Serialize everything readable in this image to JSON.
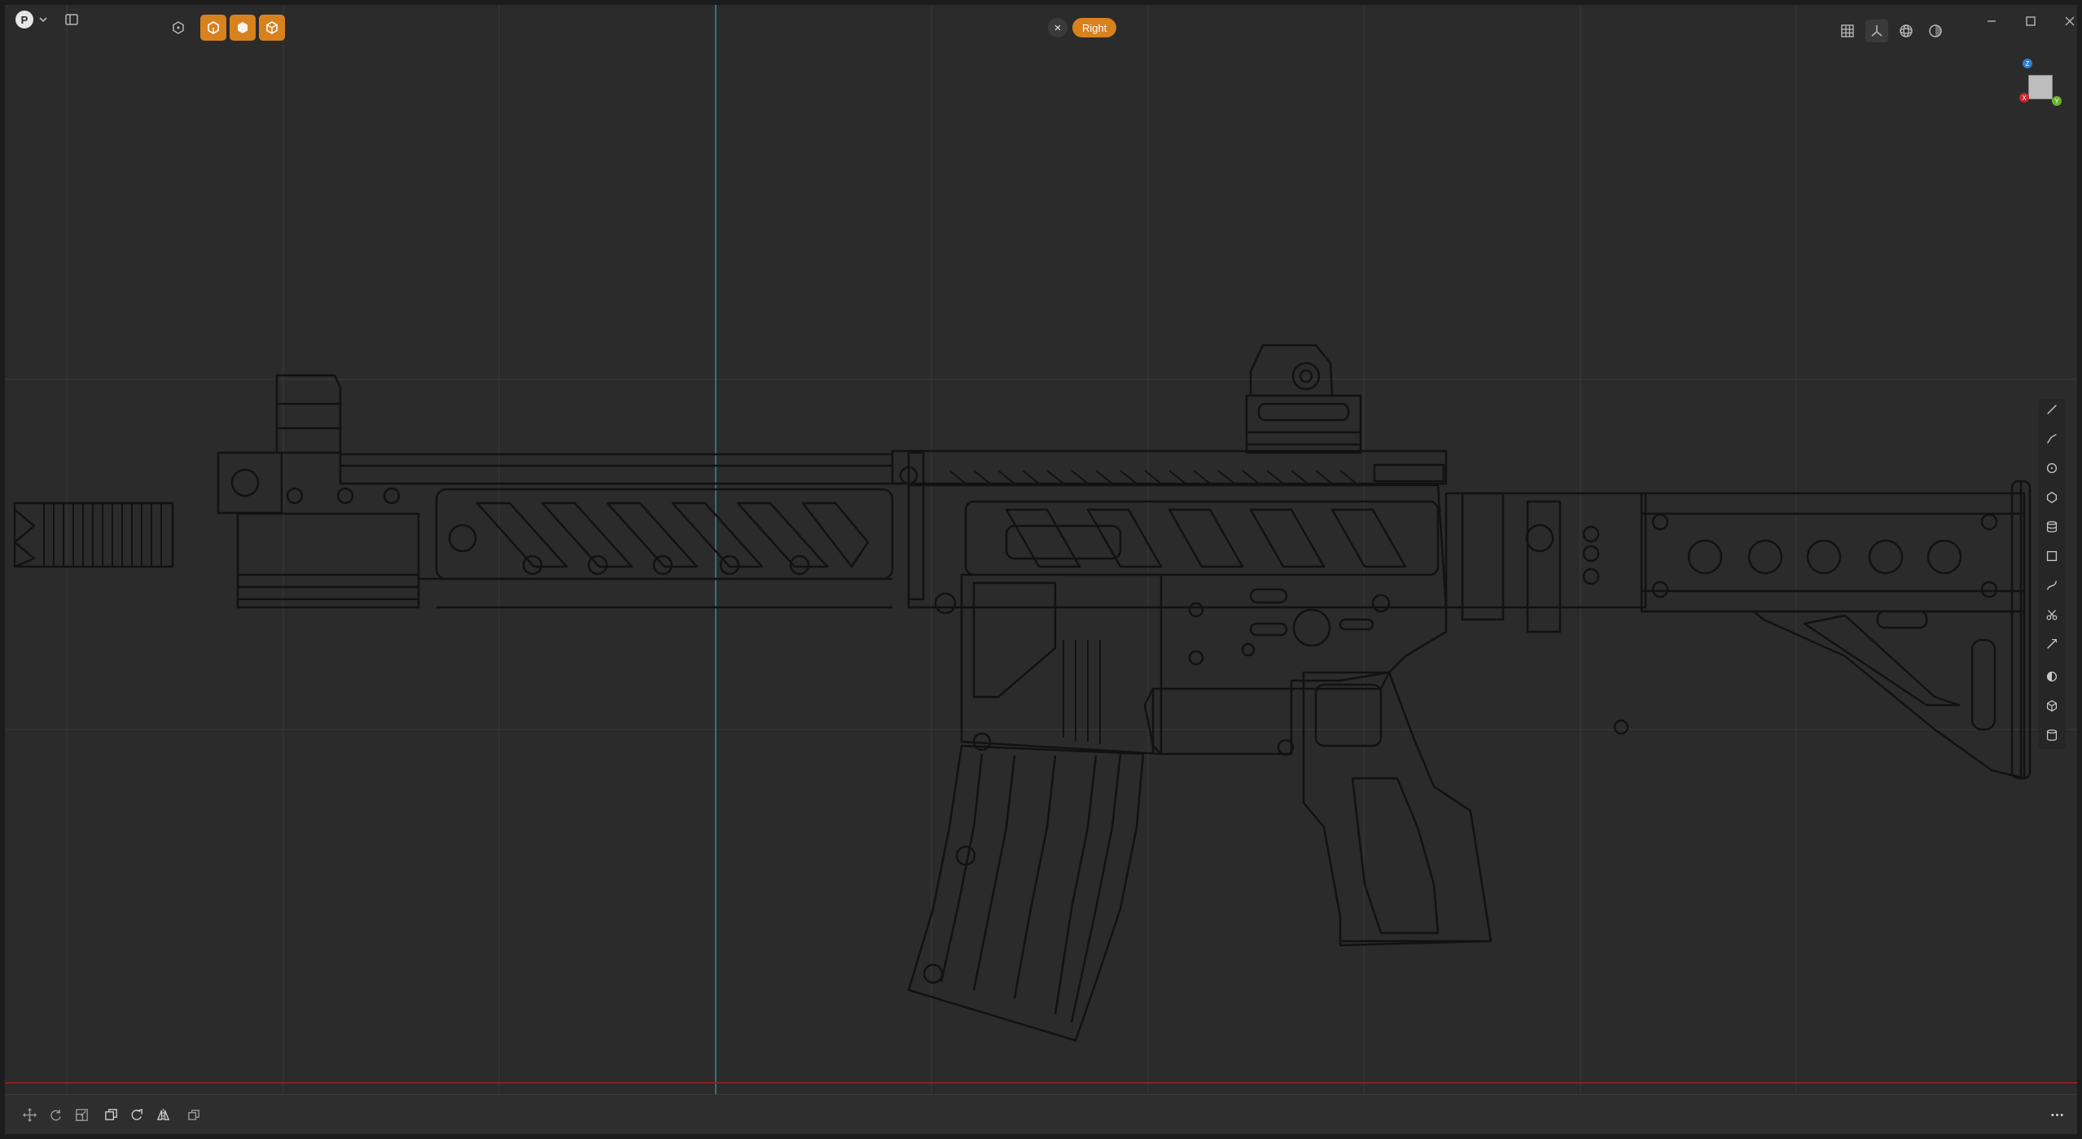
{
  "app": {
    "logo_letter": "P",
    "view_label": "Right"
  },
  "toolbar_left": [
    {
      "name": "object-mode-icon",
      "active": false
    },
    {
      "name": "solid-shading-icon",
      "active": true
    },
    {
      "name": "material-shading-icon",
      "active": true
    },
    {
      "name": "render-shading-icon",
      "active": true
    }
  ],
  "toolbar_right": [
    "grid-icon",
    "axes-icon",
    "wireframe-icon",
    "xray-icon"
  ],
  "right_tools": [
    "line-icon",
    "polyline-icon",
    "circle-icon",
    "polygon-icon",
    "cylinder-stack-icon",
    "rectangle-icon",
    "curve-icon",
    "cut-icon",
    "knife-icon",
    "half-sphere-icon",
    "cube-icon",
    "cylinder-icon"
  ],
  "bottom_tools": [
    "move-icon",
    "rotate-icon",
    "scale-icon",
    "duplicate-icon",
    "rotate-copy-icon",
    "mirror-icon",
    "array-icon"
  ],
  "gizmo": {
    "z_label": "Z",
    "x_label": "X",
    "y_label": "Y"
  },
  "colors": {
    "accent": "#d8811f",
    "red_axis": "#c8242b",
    "teal_axis": "#2c8f8c",
    "wire": "#121212"
  }
}
